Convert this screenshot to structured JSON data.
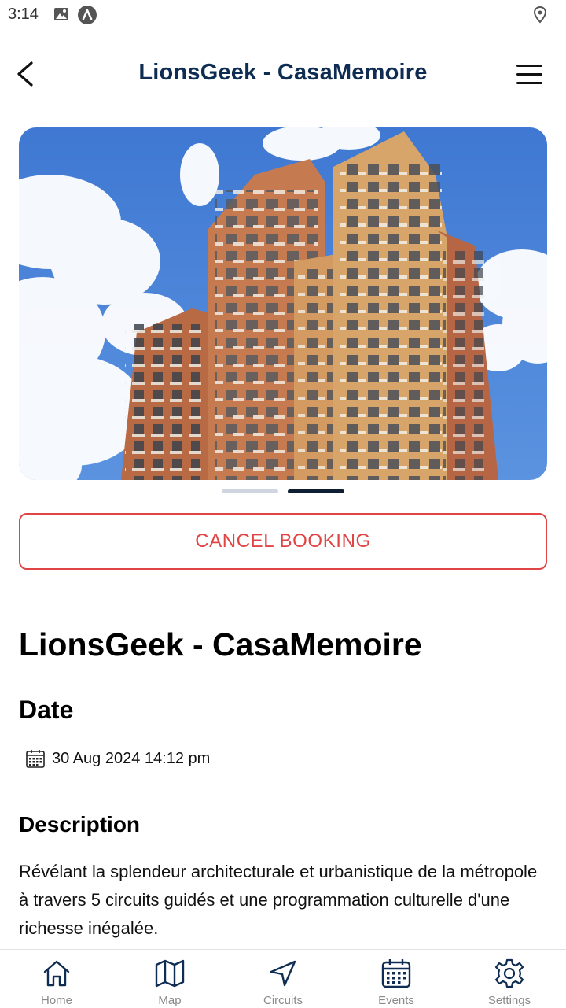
{
  "status_bar": {
    "time": "3:14"
  },
  "header": {
    "title": "LionsGeek - CasaMemoire"
  },
  "carousel": {
    "page_count": 2,
    "active_index": 1
  },
  "actions": {
    "cancel_label": "CANCEL BOOKING"
  },
  "event": {
    "title": "LionsGeek - CasaMemoire",
    "date_heading": "Date",
    "date_value": "30 Aug 2024 14:12 pm",
    "description_heading": "Description",
    "description": "Révélant la splendeur architecturale et urbanistique de la métropole à travers 5 circuits guidés et une programmation culturelle d'une richesse inégalée."
  },
  "bottom_nav": {
    "items": [
      {
        "label": "Home",
        "icon": "home-icon"
      },
      {
        "label": "Map",
        "icon": "map-icon"
      },
      {
        "label": "Circuits",
        "icon": "navigation-icon"
      },
      {
        "label": "Events",
        "icon": "calendar-icon"
      },
      {
        "label": "Settings",
        "icon": "gear-icon"
      }
    ]
  },
  "colors": {
    "header_title": "#0f2d52",
    "cancel_red": "#e04444",
    "nav_icon": "#0f2d52",
    "nav_label": "#8a8a8a"
  }
}
